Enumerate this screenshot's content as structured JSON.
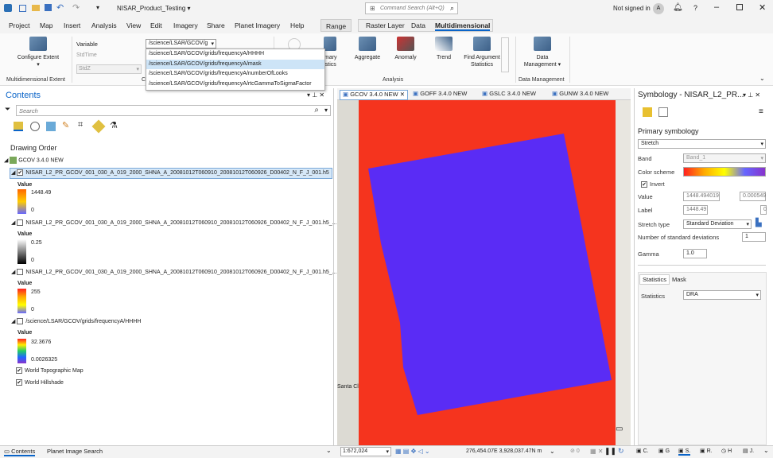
{
  "titlebar": {
    "project_title": "NISAR_Product_Testing",
    "search_placeholder": "Command Search (Alt+Q)",
    "signin": "Not signed in",
    "avatar_letter": "A",
    "help": "?"
  },
  "tabs": [
    "Project",
    "Map",
    "Insert",
    "Analysis",
    "View",
    "Edit",
    "Imagery",
    "Share",
    "Planet Imagery",
    "Help"
  ],
  "context_tabs": {
    "range": "Range",
    "raster_layer": "Raster Layer",
    "data": "Data",
    "multidimensional": "Multidimensional"
  },
  "ribbon": {
    "configure_extent": "Configure Extent",
    "variable_label": "Variable",
    "variable_value": "/science/LSAR/GCOV/g",
    "stdtime": "StdTime",
    "stdz": "StdZ",
    "group_extent": "Multidimensional Extent",
    "group_c": "C",
    "imary": "imary",
    "istics": "istics",
    "aggregate": "Aggregate",
    "anomaly": "Anomaly",
    "trend": "Trend",
    "find_arg": "Find Argument Statistics",
    "group_analysis": "Analysis",
    "data_mgmt": "Data Management",
    "group_data_mgmt": "Data Management"
  },
  "variable_dropdown": [
    "/science/LSAR/GCOV/grids/frequencyA/HHHH",
    "/science/LSAR/GCOV/grids/frequencyA/mask",
    "/science/LSAR/GCOV/grids/frequencyA/numberOfLooks",
    "/science/LSAR/GCOV/grids/frequencyA/rtcGammaToSigmaFactor"
  ],
  "contents": {
    "title": "Contents",
    "search_placeholder": "Search",
    "drawing_order": "Drawing Order",
    "map_name": "GCOV 3.4.0 NEW",
    "layers": [
      {
        "name": "NISAR_L2_PR_GCOV_001_030_A_019_2000_SHNA_A_20081012T060910_20081012T060926_D00402_N_F_J_001.h5",
        "checked": true,
        "value_label": "Value",
        "max": "1448.49",
        "min": "0"
      },
      {
        "name": "NISAR_L2_PR_GCOV_001_030_A_019_2000_SHNA_A_20081012T060910_20081012T060926_D00402_N_F_J_001.h5_...",
        "checked": false,
        "value_label": "Value",
        "max": "0.25",
        "min": "0"
      },
      {
        "name": "NISAR_L2_PR_GCOV_001_030_A_019_2000_SHNA_A_20081012T060910_20081012T060926_D00402_N_F_J_001.h5_...",
        "checked": false,
        "value_label": "Value",
        "max": "255",
        "min": "0"
      },
      {
        "name": "/science/LSAR/GCOV/grids/frequencyA/HHHH",
        "checked": false,
        "value_label": "Value",
        "max": "32.3676",
        "min": "0.0026325"
      }
    ],
    "basemaps": [
      "World Topographic Map",
      "World Hillshade"
    ]
  },
  "map_tabs": [
    "GCOV 3.4.0 NEW",
    "GOFF 3.4.0 NEW",
    "GSLC 3.4.0 NEW",
    "GUNW 3.4.0 NEW"
  ],
  "map": {
    "place_label": "Santa Cl"
  },
  "symbology": {
    "title": "Symbology - NISAR_L2_PR...",
    "primary": "Primary symbology",
    "renderer": "Stretch",
    "band_label": "Band",
    "band_value": "Band_1",
    "color_scheme_label": "Color scheme",
    "invert": "Invert",
    "value_label": "Value",
    "value_max": "1448.494019",
    "value_min": "0.000549",
    "label_label": "Label",
    "label_max": "1448.49",
    "label_min": "0",
    "stretch_type_label": "Stretch type",
    "stretch_type": "Standard Deviation",
    "num_std_label": "Number of standard deviations",
    "num_std": "1",
    "gamma_label": "Gamma",
    "gamma": "1.0",
    "tab_statistics": "Statistics",
    "tab_mask": "Mask",
    "statistics_label": "Statistics",
    "statistics_value": "DRA"
  },
  "status": {
    "tab_contents": "Contents",
    "tab_planet": "Planet Image Search",
    "scale": "1:672,024",
    "coords": "276,454.07E 3,928,037.47N m",
    "right_tabs": [
      "C.",
      "G",
      "S.",
      "R.",
      "H",
      "J."
    ],
    "zero": "0"
  },
  "colors": {
    "map_red": "#f5341e",
    "map_blue": "#5a2cf5",
    "accent": "#0a64c8"
  }
}
